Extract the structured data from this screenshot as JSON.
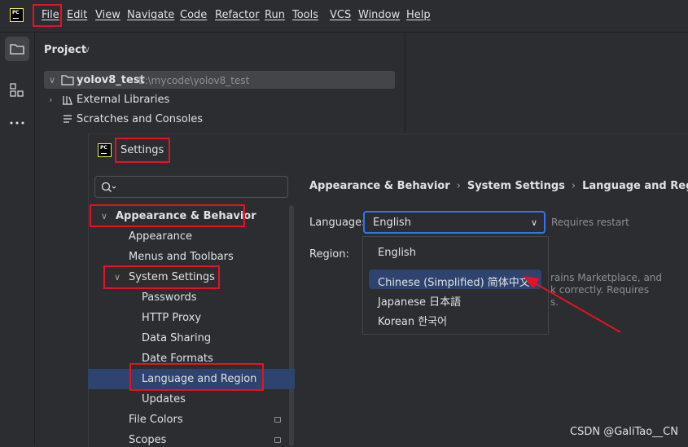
{
  "menubar": {
    "logo_text": "PC",
    "items": [
      "File",
      "Edit",
      "View",
      "Navigate",
      "Code",
      "Refactor",
      "Run",
      "Tools",
      "VCS",
      "Window",
      "Help"
    ]
  },
  "project_pane": {
    "title": "Project",
    "root_name": "yolov8_test",
    "root_path": "E:\\mycode\\yolov8_test",
    "external_libraries": "External Libraries",
    "scratches": "Scratches and Consoles"
  },
  "settings": {
    "title": "Settings",
    "nav": {
      "appearance_behavior": "Appearance & Behavior",
      "appearance": "Appearance",
      "menus_toolbars": "Menus and Toolbars",
      "system_settings": "System Settings",
      "passwords": "Passwords",
      "http_proxy": "HTTP Proxy",
      "data_sharing": "Data Sharing",
      "date_formats": "Date Formats",
      "language_region": "Language and Region",
      "updates": "Updates",
      "file_colors": "File Colors",
      "scopes": "Scopes"
    },
    "breadcrumb": [
      "Appearance & Behavior",
      "System Settings",
      "Language and Region"
    ],
    "language_label": "Language:",
    "language_value": "English",
    "requires_restart": "Requires restart",
    "region_label": "Region:",
    "hint_line1": "rains Marketplace, and",
    "hint_line2": "k correctly. Requires",
    "hint_line3": "s.",
    "options": [
      "English",
      "Chinese (Simplified) 简体中文",
      "Japanese 日本語",
      "Korean 한국어"
    ]
  },
  "watermark": "CSDN @GaliTao__CN",
  "colors": {
    "annotation_red": "#e81123",
    "selection": "#2e436e",
    "focus_border": "#3574f0"
  }
}
